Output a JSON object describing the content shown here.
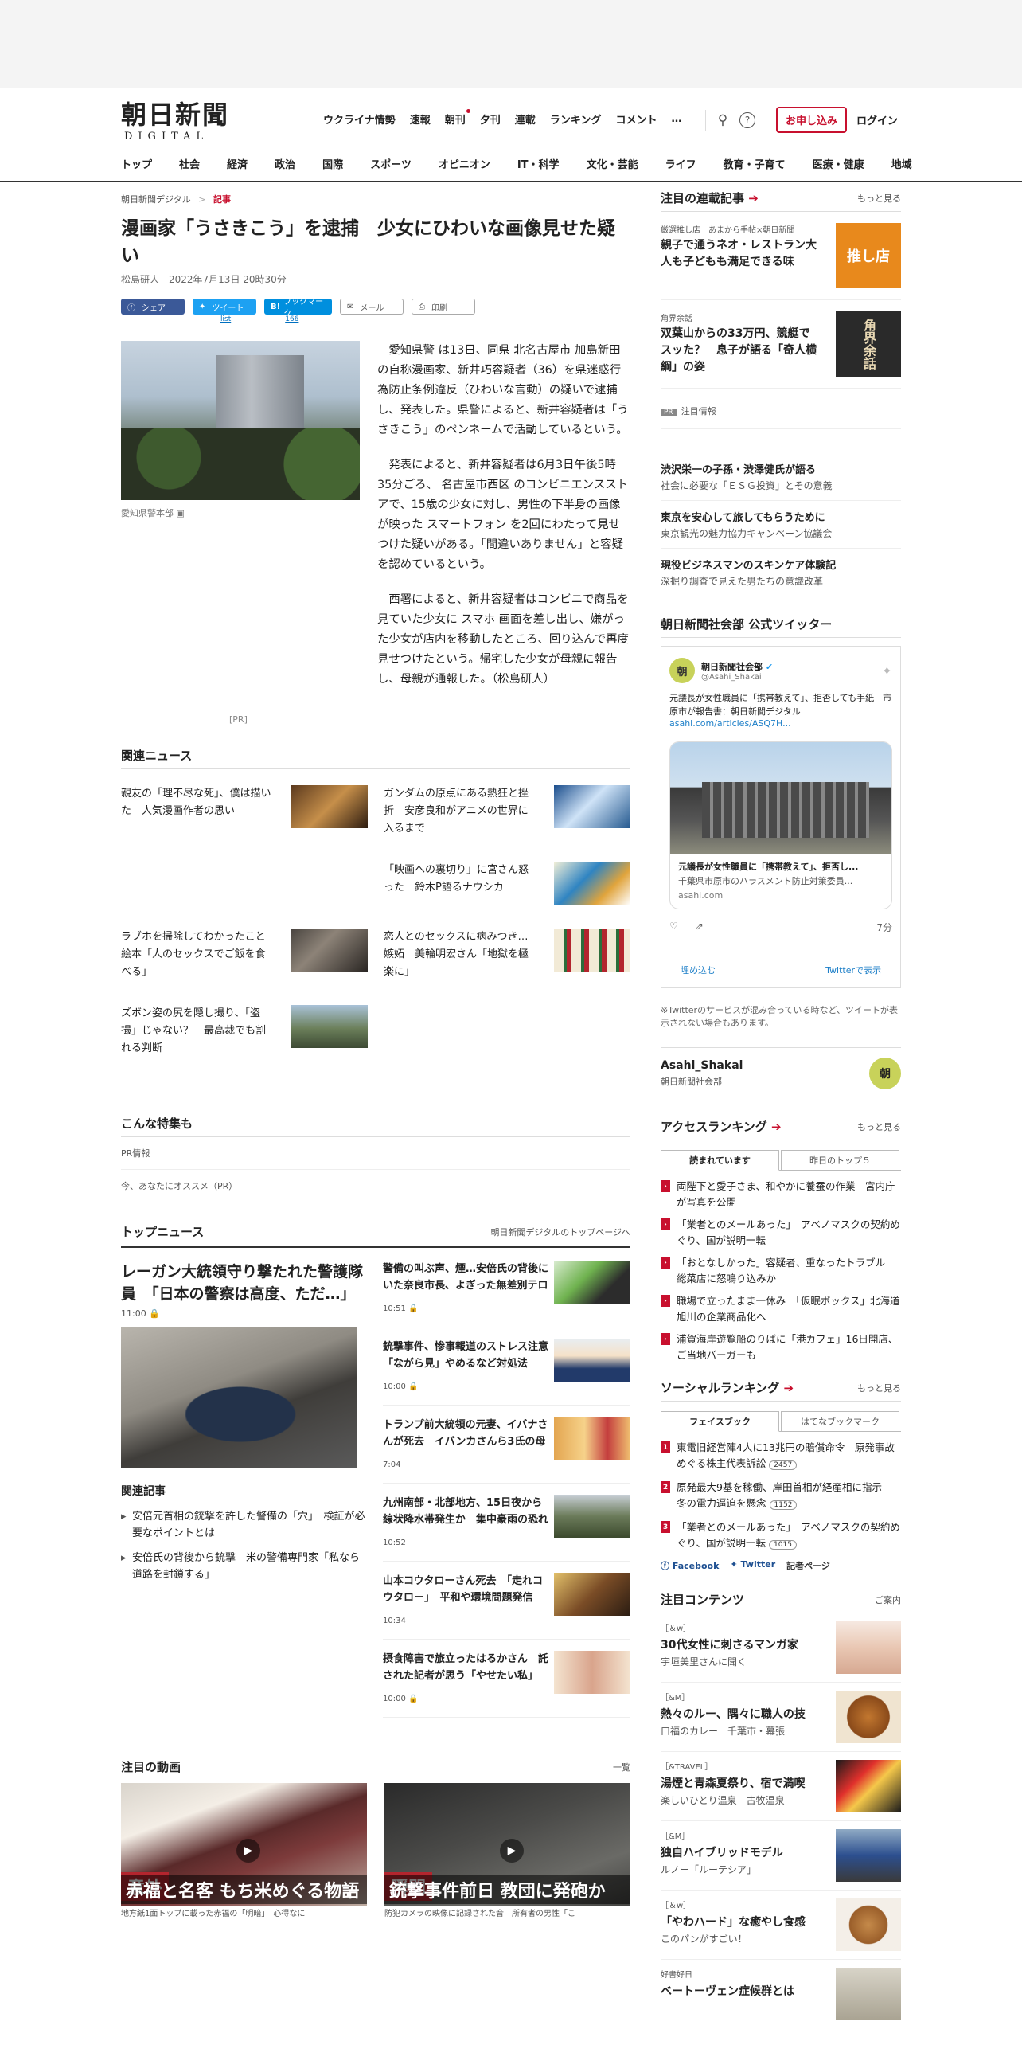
{
  "logo": {
    "main": "朝日新聞",
    "sub": "DIGITAL"
  },
  "global_nav": [
    "ウクライナ情勢",
    "速報",
    "朝刊",
    "夕刊",
    "連載",
    "ランキング",
    "コメント",
    "…"
  ],
  "header": {
    "subscribe": "お申し込み",
    "login": "ログイン"
  },
  "category_nav": [
    "トップ",
    "社会",
    "経済",
    "政治",
    "国際",
    "スポーツ",
    "オピニオン",
    "IT・科学",
    "文化・芸能",
    "ライフ",
    "教育・子育て",
    "医療・健康",
    "地域"
  ],
  "breadcrumb": {
    "home": "朝日新聞デジタル",
    "sep": ">",
    "current": "記事"
  },
  "article": {
    "title": "漫画家「うさきこう」を逮捕　少女にひわいな画像見せた疑い",
    "byline": "松島研人　2022年7月13日 20時30分",
    "share": {
      "facebook": "シェア",
      "twitter": "ツイート",
      "tweet_count": "list",
      "hatena": "ブックマーク",
      "hatena_count": "166",
      "mail": "メール",
      "print": "印刷"
    },
    "photo_caption": "愛知県警本部",
    "paragraphs": [
      "愛知県警 は13日、同県 北名古屋市 加島新田の自称漫画家、新井巧容疑者（36）を県迷惑行為防止条例違反（ひわいな言動）の疑いで逮捕し、発表した。県警によると、新井容疑者は「うさきこう」のペンネームで活動しているという。",
      "発表によると、新井容疑者は6月3日午後5時35分ごろ、 名古屋市西区 のコンビニエンスストアで、15歳の少女に対し、男性の下半身の画像が映った スマートフォン を2回にわたって見せつけた疑いがある。「間違いありません」と容疑を認めているという。",
      "西署によると、新井容疑者はコンビニで商品を見ていた少女に スマホ 画面を差し出し、嫌がった少女が店内を移動したところ、回り込んで再度見せつけたという。帰宅した少女が母親に報告し、母親が通報した。（松島研人）"
    ],
    "pr": "[PR]"
  },
  "related_news": {
    "heading": "関連ニュース",
    "items": [
      "親友の「理不尽な死」、僕は描いた　人気漫画作者の思い",
      "ガンダムの原点にある熱狂と挫折　安彦良和がアニメの世界に入るまで",
      "",
      "「映画への裏切り」に宮さん怒った　鈴木P語るナウシカ",
      "ラブホを掃除してわかったこと　絵本「人のセックスでご飯を食べる」",
      "恋人とのセックスに病みつき…嫉妬　美輪明宏さん「地獄を極楽に」",
      "ズボン姿の尻を隠し撮り、「盗撮」じゃない？　最高裁でも割れる判断",
      ""
    ]
  },
  "feature": {
    "heading": "こんな特集も",
    "pr_info": "PR情報",
    "recommend": "今、あなたにオススメ（PR）"
  },
  "top_news": {
    "heading": "トップニュース",
    "link": "朝日新聞デジタルのトップページへ",
    "lead": "レーガン大統領守り撃たれた警護隊員　「日本の警察は高度、ただ…」",
    "lead_time": "11:00",
    "related_heading": "関連記事",
    "related": [
      "安倍元首相の銃撃を許した警備の「穴」　検証が必要なポイントとは",
      "安倍氏の背後から銃撃　米の警備専門家「私なら道路を封鎖する」"
    ],
    "items": [
      {
        "title": "警備の叫ぶ声、煙…安倍氏の背後にいた奈良市長、よぎった無差別テロ",
        "time": "10:51"
      },
      {
        "title": "銃撃事件、惨事報道のストレス注意　「ながら見」やめるなど対処法",
        "time": "10:00"
      },
      {
        "title": "トランプ前大統領の元妻、イバナさんが死去　イバンカさんら3氏の母",
        "time": "7:04"
      },
      {
        "title": "九州南部・北部地方、15日夜から線状降水帯発生か　集中豪雨の恐れ",
        "time": "10:52"
      },
      {
        "title": "山本コウタローさん死去　「走れコウタロー」　平和や環境問題発信",
        "time": "10:34"
      },
      {
        "title": "摂食障害で旅立ったはるかさん　託された記者が思う「やせたい私」",
        "time": "10:00"
      }
    ]
  },
  "videos": {
    "heading": "注目の動画",
    "link": "一覧",
    "items": [
      {
        "tag": "意外",
        "caption": "赤福と名客 もち米めぐる物語",
        "sub": "地方紙1面トップに載った赤福の「明暗」　心得なに"
      },
      {
        "tag": "瞬間",
        "caption": "銃撃事件前日 教団に発砲か",
        "sub": "防犯カメラの映像に記録された音　所有者の男性「こ"
      }
    ]
  },
  "sidebar": {
    "series": {
      "heading": "注目の連載記事",
      "more": "もっと見る",
      "items": [
        {
          "label": "厳選推し店　あまから手帖×朝日新聞",
          "title": "親子で通うネオ・レストラン大人も子どもも満足できる味",
          "thumb": "推し店"
        },
        {
          "label": "角界余話",
          "title": "双葉山からの33万円、競艇でスッた？　息子が語る「奇人横綱」の姿",
          "thumb": "角界余話"
        }
      ]
    },
    "pr": {
      "badge": "PR",
      "label": "注目情報"
    },
    "promos": [
      {
        "title": "渋沢栄一の子孫・渋澤健氏が語る",
        "sub": "社会に必要な「ＥＳＧ投資」とその意義"
      },
      {
        "title": "東京を安心して旅してもらうために",
        "sub": "東京観光の魅力協力キャンペーン協議会"
      },
      {
        "title": "現役ビジネスマンのスキンケア体験記",
        "sub": "深掘り調査で見えた男たちの意識改革"
      }
    ],
    "twitter": {
      "heading": "朝日新聞社会部 公式ツイッター",
      "name": "朝日新聞社会部",
      "handle": "@Asahi_Shakai",
      "text": "元議長が女性職員に「携帯教えて」、拒否しても手紙　市原市が報告書：朝日新聞デジタル",
      "link": "asahi.com/articles/ASQ7H...",
      "card_title": "元議長が女性職員に「携帯教えて」、拒否し...",
      "card_sub": "千葉県市原市のハラスメント防止対策委員...",
      "card_domain": "asahi.com",
      "time": "7分",
      "embed": "埋め込む",
      "view": "Twitterで表示",
      "note": "※Twitterのサービスが混み合っている時など、ツイートが表示されない場合もあります。",
      "account": "Asahi_Shakai",
      "account_sub": "朝日新聞社会部",
      "avatar": "朝"
    },
    "access": {
      "heading": "アクセスランキング",
      "more": "もっと見る",
      "tabs": [
        "読まれています",
        "昨日のトップ５"
      ],
      "items": [
        "両陛下と愛子さま、和やかに養蚕の作業　宮内庁が写真を公開",
        "「業者とのメールあった」　アベノマスクの契約めぐり、国が説明一転",
        "「おとなしかった」容疑者、重なったトラブル　総菜店に怒鳴り込みか",
        "職場で立ったまま一休み　「仮眠ボックス」北海道旭川の企業商品化へ",
        "浦賀海岸遊覧船のりばに「港カフェ」16日開店、ご当地バーガーも"
      ]
    },
    "social": {
      "heading": "ソーシャルランキング",
      "more": "もっと見る",
      "tabs": [
        "フェイスブック",
        "はてなブックマーク"
      ],
      "items": [
        {
          "title": "東電旧経営陣4人に13兆円の賠償命令　原発事故めぐる株主代表訴訟",
          "count": "2457"
        },
        {
          "title": "原発最大9基を稼働、岸田首相が経産相に指示　冬の電力逼迫を懸念",
          "count": "1152"
        },
        {
          "title": "「業者とのメールあった」　アベノマスクの契約めぐり、国が説明一転",
          "count": "1015"
        }
      ],
      "links": [
        "Facebook",
        "Twitter",
        "記者ページ"
      ]
    },
    "contents": {
      "heading": "注目コンテンツ",
      "more": "ご案内",
      "items": [
        {
          "label": "［＆w］",
          "title": "30代女性に刺さるマンガ家",
          "sub": "宇垣美里さんに聞く"
        },
        {
          "label": "［&M］",
          "title": "熱々のルー、隅々に職人の技",
          "sub": "口福のカレー　千葉市・幕張"
        },
        {
          "label": "［&TRAVEL］",
          "title": "湯煙と青森夏祭り、宿で満喫",
          "sub": "楽しいひとり温泉　古牧温泉"
        },
        {
          "label": "［&M］",
          "title": "独自ハイブリッドモデル",
          "sub": "ルノー「ルーテシア」"
        },
        {
          "label": "［＆w］",
          "title": "「やわハード」な癒やし食感",
          "sub": "このパンがすごい！"
        },
        {
          "label": "好書好日",
          "title": "ベートーヴェン症候群とは",
          "sub": ""
        }
      ]
    }
  }
}
